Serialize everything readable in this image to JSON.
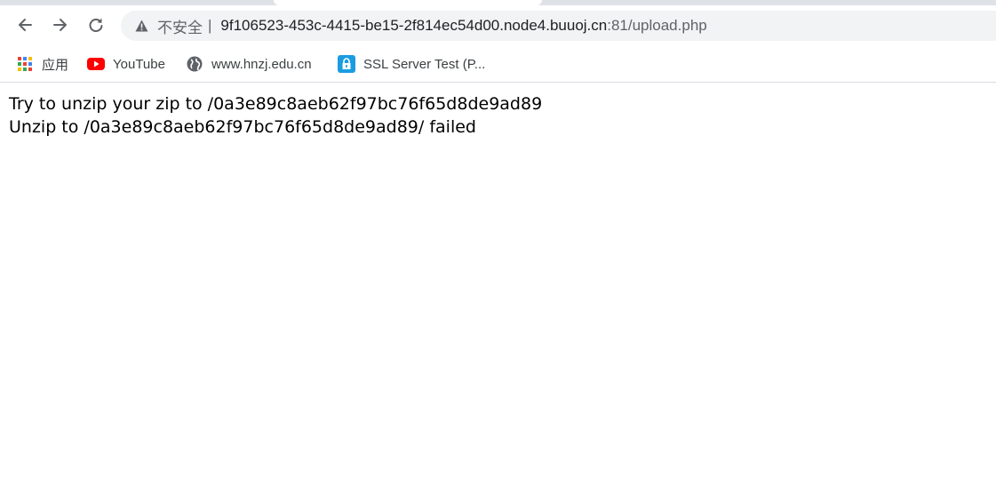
{
  "browser": {
    "address_bar": {
      "security_label": "不安全",
      "separator": "|",
      "host": "9f106523-453c-4415-be15-2f814ec54d00.node4.buuoj.cn",
      "port_path": ":81/upload.php"
    },
    "bookmarks": [
      {
        "label": "应用",
        "icon": "apps-grid-icon"
      },
      {
        "label": "YouTube",
        "icon": "youtube-icon"
      },
      {
        "label": "www.hnzj.edu.cn",
        "icon": "globe-icon"
      },
      {
        "label": "SSL Server Test (P...",
        "icon": "ssl-lock-icon"
      }
    ]
  },
  "page": {
    "lines": [
      "Try to unzip your zip to /0a3e89c8aeb62f97bc76f65d8de9ad89",
      "Unzip to /0a3e89c8aeb62f97bc76f65d8de9ad89/ failed"
    ]
  },
  "colors": {
    "tabstrip": "#dee1e6",
    "omnibox_bg": "#f1f3f4",
    "youtube_red": "#ff0000",
    "ssl_blue": "#1a9ce0"
  }
}
